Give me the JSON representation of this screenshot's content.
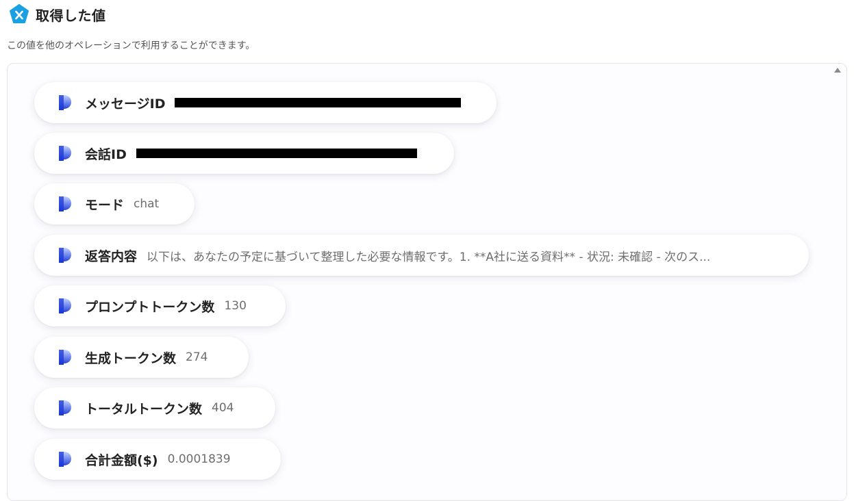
{
  "header": {
    "title": "取得した値",
    "icon": "yoom-x-icon",
    "accent_color": "#1ba1e2"
  },
  "subtitle": "この値を他のオペレーションで利用することができます。",
  "items": [
    {
      "label": "メッセージID",
      "value": "",
      "redacted": true
    },
    {
      "label": "会話ID",
      "value": "",
      "redacted": true
    },
    {
      "label": "モード",
      "value": "chat"
    },
    {
      "label": "返答内容",
      "value": "以下は、あなたの予定に基づいて整理した必要な情報です。1. **A社に送る資料** - 状況: 未確認 - 次のス..."
    },
    {
      "label": "プロンプトトークン数",
      "value": "130"
    },
    {
      "label": "生成トークン数",
      "value": "274"
    },
    {
      "label": "トータルトークン数",
      "value": "404"
    },
    {
      "label": "合計金額($)",
      "value": "0.0001839"
    }
  ],
  "colors": {
    "item_icon_top": "#a9c2ff",
    "item_icon_bottom": "#1a37d6",
    "redaction": "#000000"
  }
}
